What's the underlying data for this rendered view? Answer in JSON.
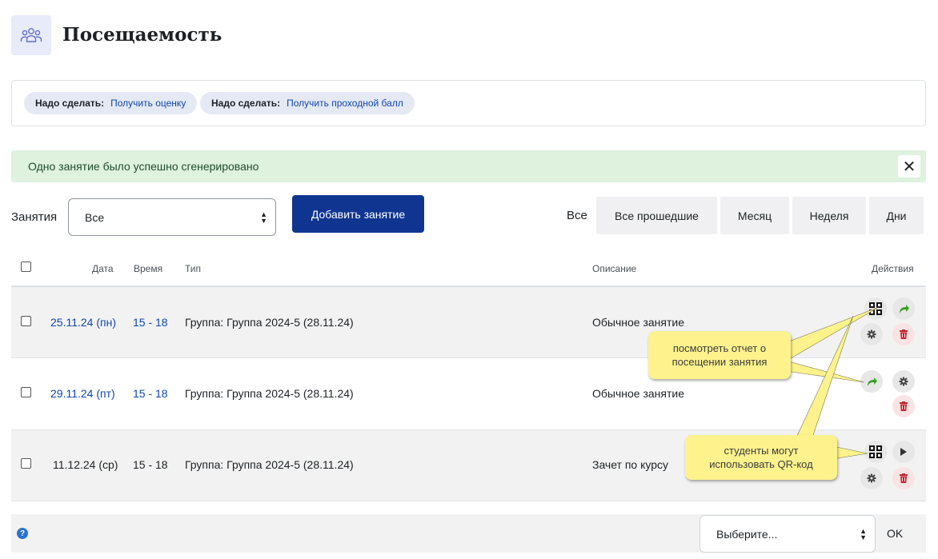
{
  "page": {
    "title": "Посещаемость",
    "icon": "users-icon"
  },
  "completion": [
    {
      "label": "Надо сделать:",
      "value": "Получить оценку"
    },
    {
      "label": "Надо сделать:",
      "value": "Получить проходной балл"
    }
  ],
  "alert": {
    "text": "Одно занятие было успешно сгенерировано",
    "close": "✕"
  },
  "filters": {
    "sessions_label": "Занятия",
    "sessions_select": "Все",
    "add_button": "Добавить занятие",
    "current_period": "Все",
    "periods": [
      "Все прошедшие",
      "Месяц",
      "Неделя",
      "Дни"
    ]
  },
  "table": {
    "headers": {
      "date": "Дата",
      "time": "Время",
      "type": "Тип",
      "description": "Описание",
      "actions": "Действия"
    },
    "rows": [
      {
        "date": "25.11.24 (пн)",
        "time": "15 - 18",
        "type": "Группа: Группа 2024-5 (28.11.24)",
        "description": "Обычное занятие"
      },
      {
        "date": "29.11.24 (пт)",
        "time": "15 - 18",
        "type": "Группа: Группа 2024-5 (28.11.24)",
        "description": "Обычное занятие"
      },
      {
        "date": "11.12.24 (ср)",
        "time": "15 - 18",
        "type": "Группа: Группа 2024-5 (28.11.24)",
        "description": "Зачет по курсу"
      }
    ]
  },
  "footer": {
    "help": "?",
    "select": "Выберите...",
    "ok": "OK"
  },
  "callouts": {
    "report": "посмотреть отчет о посещении занятия",
    "qr": "студенты могут использовать QR-код"
  },
  "colors": {
    "primary": "#0f3591",
    "link": "#0f47ad",
    "success_bg": "#def2de",
    "callout": "#fdf28c",
    "delete": "#c0262b",
    "take": "#3d9b22"
  }
}
